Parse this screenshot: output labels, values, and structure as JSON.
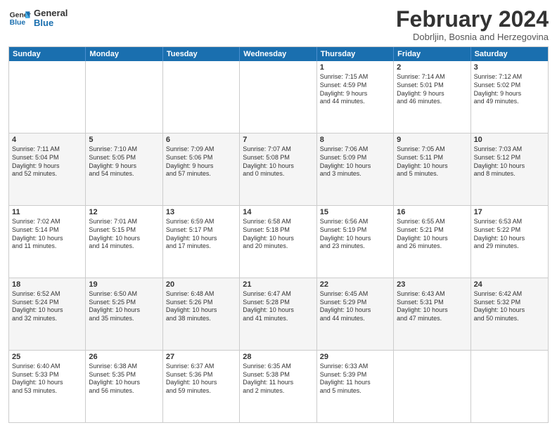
{
  "logo": {
    "line1": "General",
    "line2": "Blue"
  },
  "title": "February 2024",
  "location": "Dobrljin, Bosnia and Herzegovina",
  "days": [
    "Sunday",
    "Monday",
    "Tuesday",
    "Wednesday",
    "Thursday",
    "Friday",
    "Saturday"
  ],
  "rows": [
    [
      {
        "num": "",
        "text": ""
      },
      {
        "num": "",
        "text": ""
      },
      {
        "num": "",
        "text": ""
      },
      {
        "num": "",
        "text": ""
      },
      {
        "num": "1",
        "text": "Sunrise: 7:15 AM\nSunset: 4:59 PM\nDaylight: 9 hours\nand 44 minutes."
      },
      {
        "num": "2",
        "text": "Sunrise: 7:14 AM\nSunset: 5:01 PM\nDaylight: 9 hours\nand 46 minutes."
      },
      {
        "num": "3",
        "text": "Sunrise: 7:12 AM\nSunset: 5:02 PM\nDaylight: 9 hours\nand 49 minutes."
      }
    ],
    [
      {
        "num": "4",
        "text": "Sunrise: 7:11 AM\nSunset: 5:04 PM\nDaylight: 9 hours\nand 52 minutes."
      },
      {
        "num": "5",
        "text": "Sunrise: 7:10 AM\nSunset: 5:05 PM\nDaylight: 9 hours\nand 54 minutes."
      },
      {
        "num": "6",
        "text": "Sunrise: 7:09 AM\nSunset: 5:06 PM\nDaylight: 9 hours\nand 57 minutes."
      },
      {
        "num": "7",
        "text": "Sunrise: 7:07 AM\nSunset: 5:08 PM\nDaylight: 10 hours\nand 0 minutes."
      },
      {
        "num": "8",
        "text": "Sunrise: 7:06 AM\nSunset: 5:09 PM\nDaylight: 10 hours\nand 3 minutes."
      },
      {
        "num": "9",
        "text": "Sunrise: 7:05 AM\nSunset: 5:11 PM\nDaylight: 10 hours\nand 5 minutes."
      },
      {
        "num": "10",
        "text": "Sunrise: 7:03 AM\nSunset: 5:12 PM\nDaylight: 10 hours\nand 8 minutes."
      }
    ],
    [
      {
        "num": "11",
        "text": "Sunrise: 7:02 AM\nSunset: 5:14 PM\nDaylight: 10 hours\nand 11 minutes."
      },
      {
        "num": "12",
        "text": "Sunrise: 7:01 AM\nSunset: 5:15 PM\nDaylight: 10 hours\nand 14 minutes."
      },
      {
        "num": "13",
        "text": "Sunrise: 6:59 AM\nSunset: 5:17 PM\nDaylight: 10 hours\nand 17 minutes."
      },
      {
        "num": "14",
        "text": "Sunrise: 6:58 AM\nSunset: 5:18 PM\nDaylight: 10 hours\nand 20 minutes."
      },
      {
        "num": "15",
        "text": "Sunrise: 6:56 AM\nSunset: 5:19 PM\nDaylight: 10 hours\nand 23 minutes."
      },
      {
        "num": "16",
        "text": "Sunrise: 6:55 AM\nSunset: 5:21 PM\nDaylight: 10 hours\nand 26 minutes."
      },
      {
        "num": "17",
        "text": "Sunrise: 6:53 AM\nSunset: 5:22 PM\nDaylight: 10 hours\nand 29 minutes."
      }
    ],
    [
      {
        "num": "18",
        "text": "Sunrise: 6:52 AM\nSunset: 5:24 PM\nDaylight: 10 hours\nand 32 minutes."
      },
      {
        "num": "19",
        "text": "Sunrise: 6:50 AM\nSunset: 5:25 PM\nDaylight: 10 hours\nand 35 minutes."
      },
      {
        "num": "20",
        "text": "Sunrise: 6:48 AM\nSunset: 5:26 PM\nDaylight: 10 hours\nand 38 minutes."
      },
      {
        "num": "21",
        "text": "Sunrise: 6:47 AM\nSunset: 5:28 PM\nDaylight: 10 hours\nand 41 minutes."
      },
      {
        "num": "22",
        "text": "Sunrise: 6:45 AM\nSunset: 5:29 PM\nDaylight: 10 hours\nand 44 minutes."
      },
      {
        "num": "23",
        "text": "Sunrise: 6:43 AM\nSunset: 5:31 PM\nDaylight: 10 hours\nand 47 minutes."
      },
      {
        "num": "24",
        "text": "Sunrise: 6:42 AM\nSunset: 5:32 PM\nDaylight: 10 hours\nand 50 minutes."
      }
    ],
    [
      {
        "num": "25",
        "text": "Sunrise: 6:40 AM\nSunset: 5:33 PM\nDaylight: 10 hours\nand 53 minutes."
      },
      {
        "num": "26",
        "text": "Sunrise: 6:38 AM\nSunset: 5:35 PM\nDaylight: 10 hours\nand 56 minutes."
      },
      {
        "num": "27",
        "text": "Sunrise: 6:37 AM\nSunset: 5:36 PM\nDaylight: 10 hours\nand 59 minutes."
      },
      {
        "num": "28",
        "text": "Sunrise: 6:35 AM\nSunset: 5:38 PM\nDaylight: 11 hours\nand 2 minutes."
      },
      {
        "num": "29",
        "text": "Sunrise: 6:33 AM\nSunset: 5:39 PM\nDaylight: 11 hours\nand 5 minutes."
      },
      {
        "num": "",
        "text": ""
      },
      {
        "num": "",
        "text": ""
      }
    ]
  ]
}
